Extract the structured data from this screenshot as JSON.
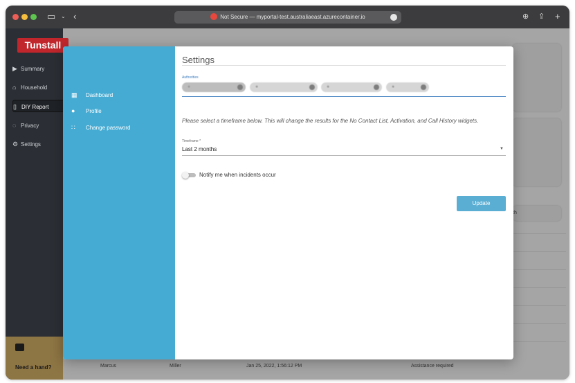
{
  "browser": {
    "url_text": "Not Secure — myportal-test.australiaeast.azurecontainer.io"
  },
  "app": {
    "logo": "Tunstall",
    "nav": [
      {
        "label": "Summary",
        "icon": "play-icon"
      },
      {
        "label": "Household",
        "icon": "house-icon"
      },
      {
        "label": "DIY Report",
        "icon": "document-icon"
      },
      {
        "label": "Privacy",
        "icon": "shield-icon"
      },
      {
        "label": "Settings",
        "icon": "gear-icon"
      }
    ],
    "help_label": "Need a hand?",
    "background_row": {
      "first_name": "Marcus",
      "last_name": "Miller",
      "date": "Jan 25, 2022, 1:56:12 PM",
      "status": "Assistance required"
    },
    "bg_partial_text": "th"
  },
  "modal": {
    "nav": [
      {
        "label": "Dashboard",
        "icon": "dashboard-icon"
      },
      {
        "label": "Profile",
        "icon": "person-icon"
      },
      {
        "label": "Change password",
        "icon": "password-icon"
      }
    ],
    "title": "Settings",
    "authorities_label": "Authorities",
    "description": "Please select a timeframe below. This will change the results for the No Contact List, Activation, and Call History widgets.",
    "timeframe_label": "Timeframe *",
    "timeframe_value": "Last 2 months",
    "notify_label": "Notify me when incidents occur",
    "notify_on": false,
    "update_label": "Update"
  }
}
